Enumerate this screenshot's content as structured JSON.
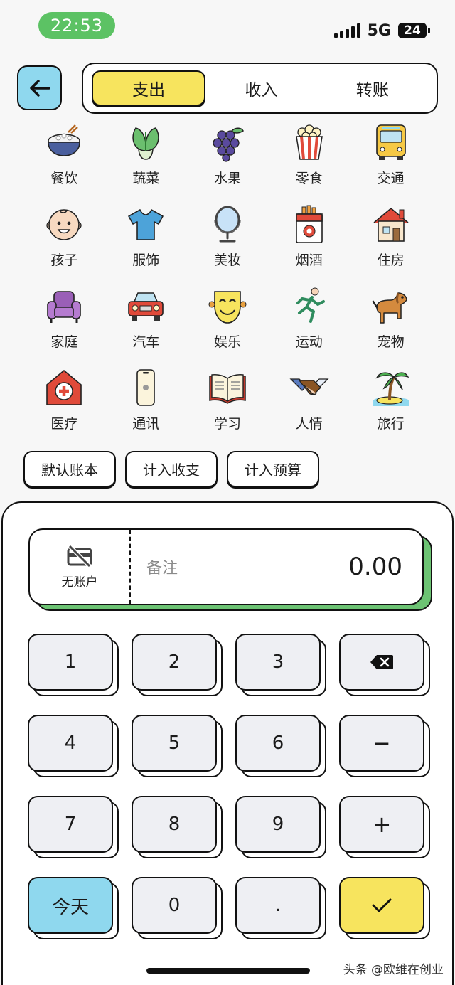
{
  "status": {
    "time": "22:53",
    "network": "5G",
    "battery": "24"
  },
  "header": {
    "tabs": [
      {
        "label": "支出",
        "active": true
      },
      {
        "label": "收入",
        "active": false
      },
      {
        "label": "转账",
        "active": false
      }
    ]
  },
  "categories": [
    {
      "label": "餐饮",
      "icon": "rice-bowl-icon"
    },
    {
      "label": "蔬菜",
      "icon": "bok-choy-icon"
    },
    {
      "label": "水果",
      "icon": "grapes-icon"
    },
    {
      "label": "零食",
      "icon": "popcorn-icon"
    },
    {
      "label": "交通",
      "icon": "bus-icon"
    },
    {
      "label": "孩子",
      "icon": "baby-face-icon"
    },
    {
      "label": "服饰",
      "icon": "tshirt-icon"
    },
    {
      "label": "美妆",
      "icon": "mirror-icon"
    },
    {
      "label": "烟酒",
      "icon": "cigarette-pack-icon"
    },
    {
      "label": "住房",
      "icon": "house-icon"
    },
    {
      "label": "家庭",
      "icon": "armchair-icon"
    },
    {
      "label": "汽车",
      "icon": "car-icon"
    },
    {
      "label": "娱乐",
      "icon": "theater-mask-icon"
    },
    {
      "label": "运动",
      "icon": "running-person-icon"
    },
    {
      "label": "宠物",
      "icon": "dog-icon"
    },
    {
      "label": "医疗",
      "icon": "hospital-icon"
    },
    {
      "label": "通讯",
      "icon": "phone-icon"
    },
    {
      "label": "学习",
      "icon": "open-book-icon"
    },
    {
      "label": "人情",
      "icon": "handshake-icon"
    },
    {
      "label": "旅行",
      "icon": "palm-tree-icon"
    }
  ],
  "chips": [
    "默认账本",
    "计入收支",
    "计入预算"
  ],
  "entry": {
    "account_label": "无账户",
    "memo_placeholder": "备注",
    "amount": "0.00"
  },
  "keypad": {
    "k1": "1",
    "k2": "2",
    "k3": "3",
    "k4": "4",
    "k5": "5",
    "k6": "6",
    "k7": "7",
    "k8": "8",
    "k9": "9",
    "minus": "−",
    "plus": "+",
    "today": "今天",
    "k0": "0",
    "dot": "."
  },
  "watermark": "头条 @欧维在创业",
  "colors": {
    "accent_yellow": "#f7e45e",
    "accent_blue": "#8fd8ee",
    "accent_green": "#6cc373",
    "status_green": "#5cc264"
  }
}
